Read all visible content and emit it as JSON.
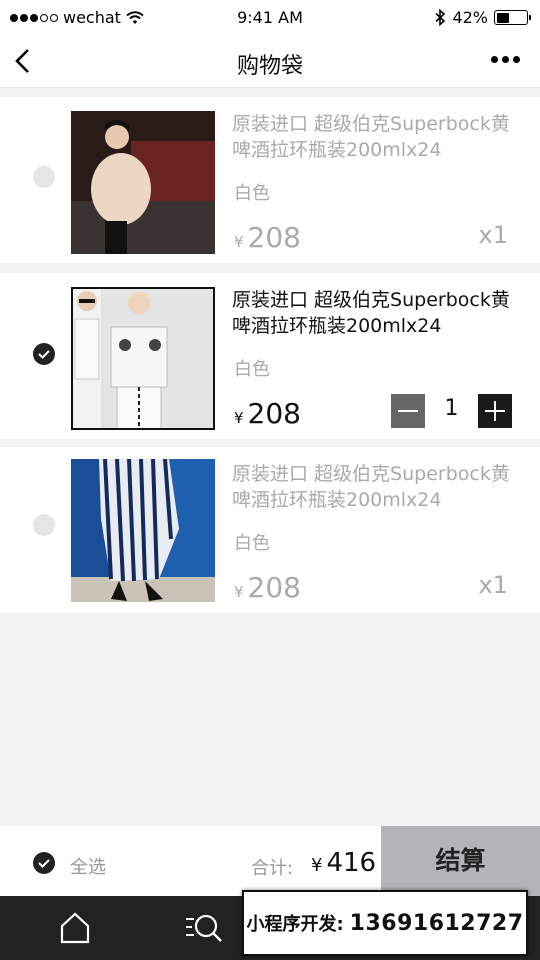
{
  "status_bar": {
    "carrier": "wechat",
    "time": "9:41 AM",
    "battery": "42%",
    "battery_level": 0.42
  },
  "nav": {
    "title": "购物袋",
    "back_icon": "chevron-left-icon",
    "more_icon": "more-dots-icon"
  },
  "items": [
    {
      "title": "原装进口 超级伯克Superbock黄啤酒拉环瓶装200mlx24",
      "variant": "白色",
      "currency": "¥",
      "price": "208",
      "quantity_label": "x1",
      "checked": false
    },
    {
      "title": "原装进口 超级伯克Superbock黄啤酒拉环瓶装200mlx24",
      "variant": "白色",
      "currency": "¥",
      "price": "208",
      "quantity": "1",
      "checked": true
    },
    {
      "title": "原装进口 超级伯克Superbock黄啤酒拉环瓶装200mlx24",
      "variant": "白色",
      "currency": "¥",
      "price": "208",
      "quantity_label": "x1",
      "checked": false
    }
  ],
  "checkout": {
    "select_all_label": "全选",
    "total_label": "合计:",
    "currency": "¥",
    "total": "416",
    "button_label": "结算"
  },
  "tab_bar": {
    "icons": [
      "home-icon",
      "search-icon"
    ]
  },
  "ad": {
    "label": "小程序开发:",
    "phone": "13691612727"
  },
  "colors": {
    "accent_dark": "#222222",
    "muted_text": "#aaaaaa",
    "checkout_button": "#b3b3b9",
    "background": "#f4f4f4"
  }
}
